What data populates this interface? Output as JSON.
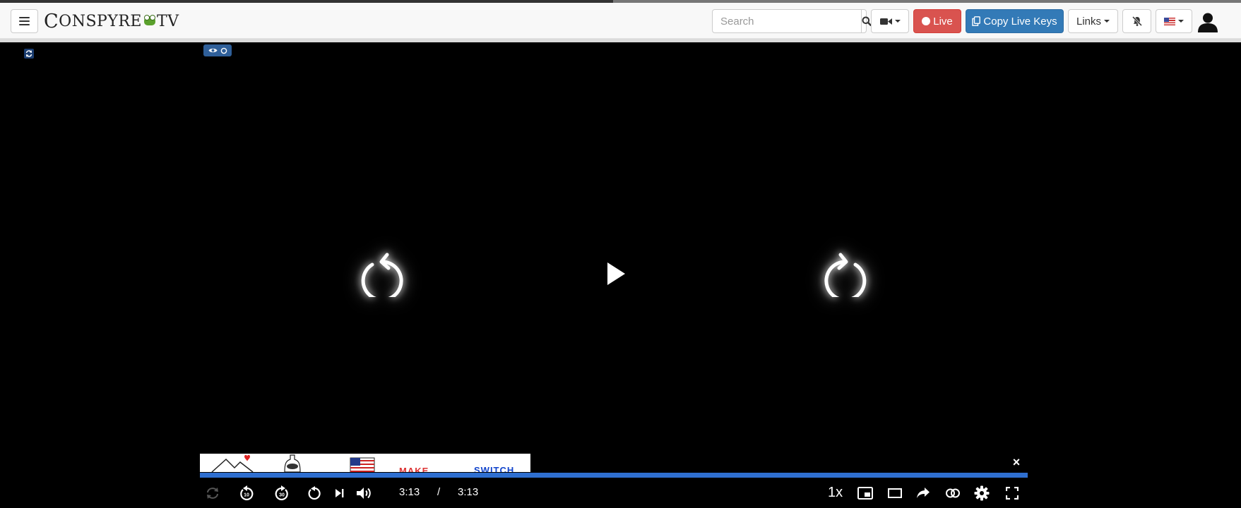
{
  "header": {
    "menu_icon": "hamburger-icon",
    "logo": {
      "first": "C",
      "rest": "ONSPYRE",
      "suffix": "TV",
      "icon": "frog-icon"
    },
    "search": {
      "placeholder": "Search",
      "value": "",
      "icon": "search-icon"
    },
    "camera": {
      "icon": "video-camera-icon"
    },
    "live_button": {
      "label": "Live",
      "icon": "record-dot-icon",
      "color": "#d9534f"
    },
    "copy_keys_button": {
      "label": "Copy Live Keys",
      "icon": "copy-icon",
      "color": "#337ab7"
    },
    "links_dropdown": {
      "label": "Links"
    },
    "notifications": {
      "icon": "bell-slash-icon"
    },
    "language": {
      "icon": "us-flag-icon"
    },
    "account": {
      "icon": "user-silhouette-icon"
    }
  },
  "player": {
    "badges": {
      "refresh_icon": "sync-icon",
      "view_icons": [
        "eye-icon",
        "circle-icon"
      ]
    },
    "center": {
      "rewind_icon": "rotate-left-icon",
      "play_icon": "play-icon",
      "forward_icon": "rotate-right-icon"
    },
    "ad": {
      "text_left": "MAKE",
      "text_right": "SWITCH",
      "close_label": "×"
    },
    "progress_fraction": 1.0,
    "accent": "#2f6fd0",
    "controls": {
      "current_time": "3:13",
      "separator": "/",
      "duration": "3:13",
      "playback_rate": "1x",
      "icons_left": [
        "loop-icon",
        "rewind-10-icon",
        "forward-30-icon",
        "replay-icon",
        "next-icon",
        "volume-icon"
      ],
      "icons_right": [
        "pip-icon",
        "theater-icon",
        "share-icon",
        "toggle-icon",
        "settings-icon",
        "fullscreen-icon"
      ]
    }
  }
}
